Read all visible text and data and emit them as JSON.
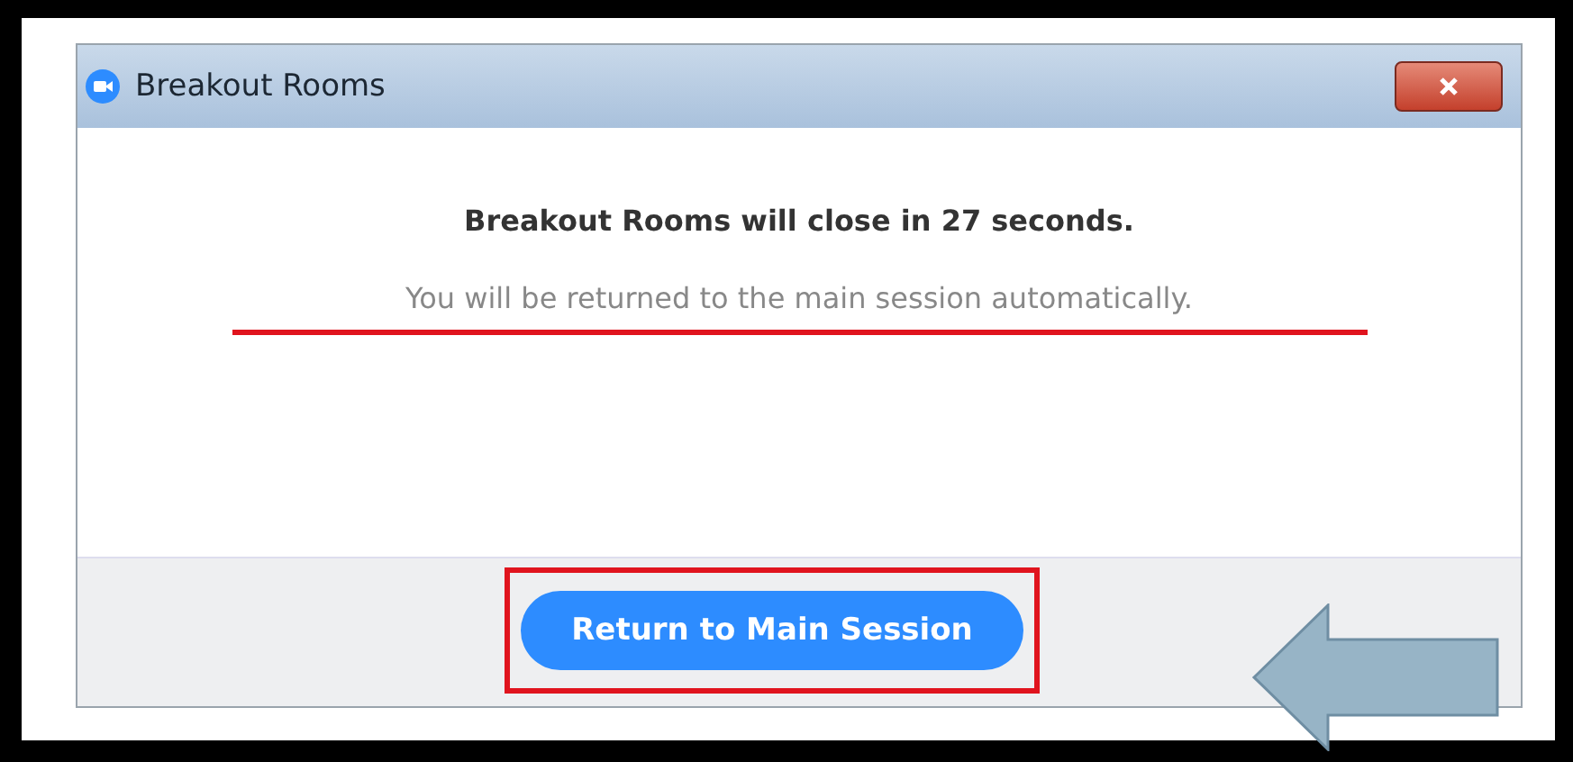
{
  "window": {
    "title": "Breakout Rooms"
  },
  "message": "Breakout Rooms will close in 27 seconds.",
  "submessage": "You will be returned to the main session automatically.",
  "button": {
    "label": "Return to Main Session"
  }
}
